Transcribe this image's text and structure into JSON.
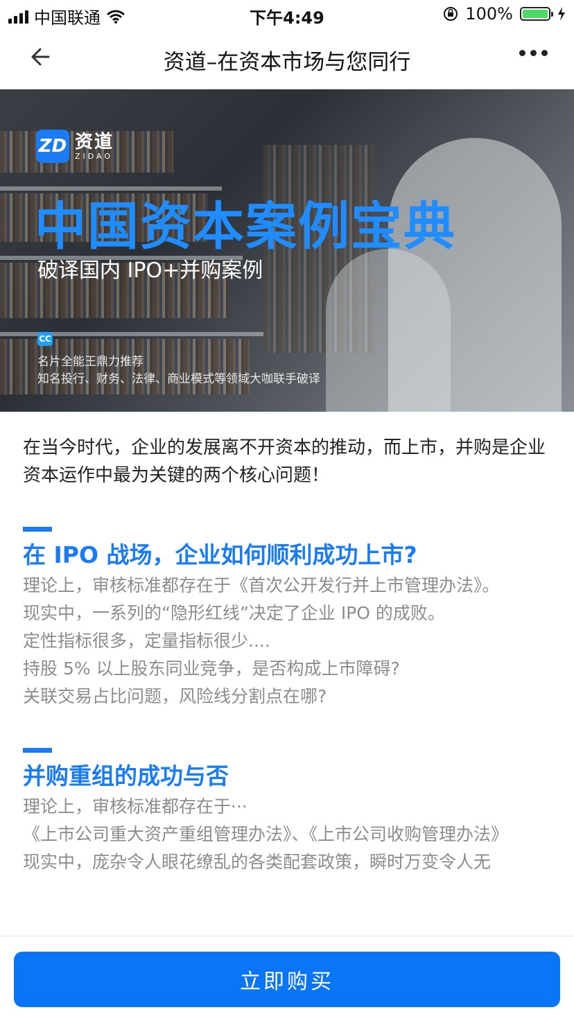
{
  "status": {
    "carrier": "中国联通",
    "time": "下午4:49",
    "battery": "100%"
  },
  "nav": {
    "title": "资道–在资本市场与您同行"
  },
  "banner": {
    "logo_mark": "ZD",
    "logo_cn": "资道",
    "logo_en": "ZIDAO",
    "headline": "中国资本案例宝典",
    "subtitle": "破译国内 IPO+并购案例",
    "cc_badge": "CC",
    "recommend_line1": "名片全能王鼎力推荐",
    "recommend_line2": "知名投行、财务、法律、商业模式等领域大咖联手破译"
  },
  "intro": "在当今时代，企业的发展离不开资本的推动，而上市，并购是企业资本运作中最为关键的两个核心问题！",
  "section1": {
    "heading": "在 IPO 战场，企业如何顺利成功上市?",
    "lines": [
      "理论上，审核标准都存在于《首次公开发行并上市管理办法》。",
      "现实中，一系列的“隐形红线”决定了企业 IPO 的成败。",
      "定性指标很多，定量指标很少....",
      "持股 5% 以上股东同业竞争，是否构成上市障碍?",
      "关联交易占比问题，风险线分割点在哪?"
    ]
  },
  "section2": {
    "heading": "并购重组的成功与否",
    "lines": [
      "理论上，审核标准都存在于···",
      "《上市公司重大资产重组管理办法》、《上市公司收购管理办法》",
      "现实中，庞杂令人眼花缭乱的各类配套政策，瞬时万变令人无"
    ]
  },
  "buy_button": "立即购买"
}
